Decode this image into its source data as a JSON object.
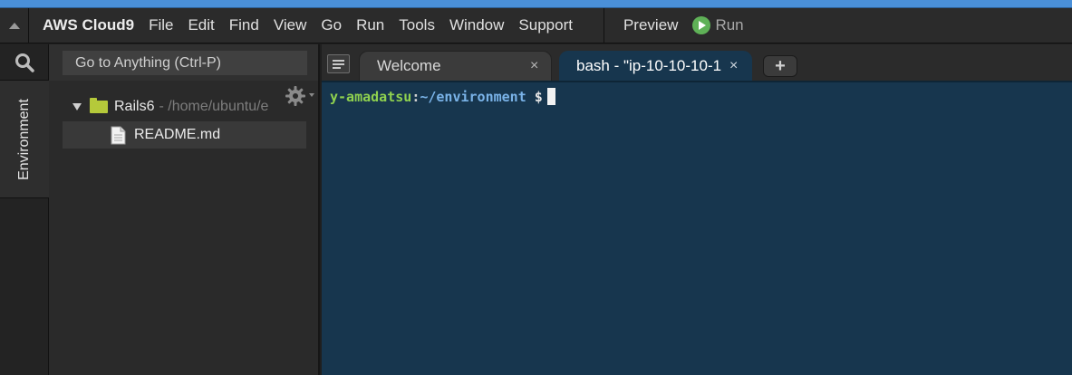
{
  "menubar": {
    "brand": "AWS Cloud9",
    "items": [
      "File",
      "Edit",
      "Find",
      "View",
      "Go",
      "Run",
      "Tools",
      "Window",
      "Support"
    ],
    "preview": "Preview",
    "run": "Run"
  },
  "leftrail": {
    "tab_label": "Environment"
  },
  "panel": {
    "goto_placeholder": "Go to Anything (Ctrl-P)",
    "tree": {
      "root_name": "Rails6",
      "root_path": "- /home/ubuntu/e",
      "files": [
        "README.md"
      ]
    }
  },
  "editor": {
    "tabs": [
      {
        "label": "Welcome",
        "close": "×"
      },
      {
        "label": "bash - \"ip-10-10-10-1",
        "close": "×"
      }
    ],
    "add_tab": "+",
    "terminal": {
      "user": "y-amadatsu",
      "colon": ":",
      "path": "~/environment",
      "dollar": " $"
    }
  },
  "colors": {
    "terminal_bg": "#17364e",
    "prompt_user": "#8fd14f",
    "prompt_path": "#7ab3e8",
    "run_icon": "#5fb157",
    "folder": "#b5c93a",
    "accent_stripe": "#4a90d9"
  }
}
